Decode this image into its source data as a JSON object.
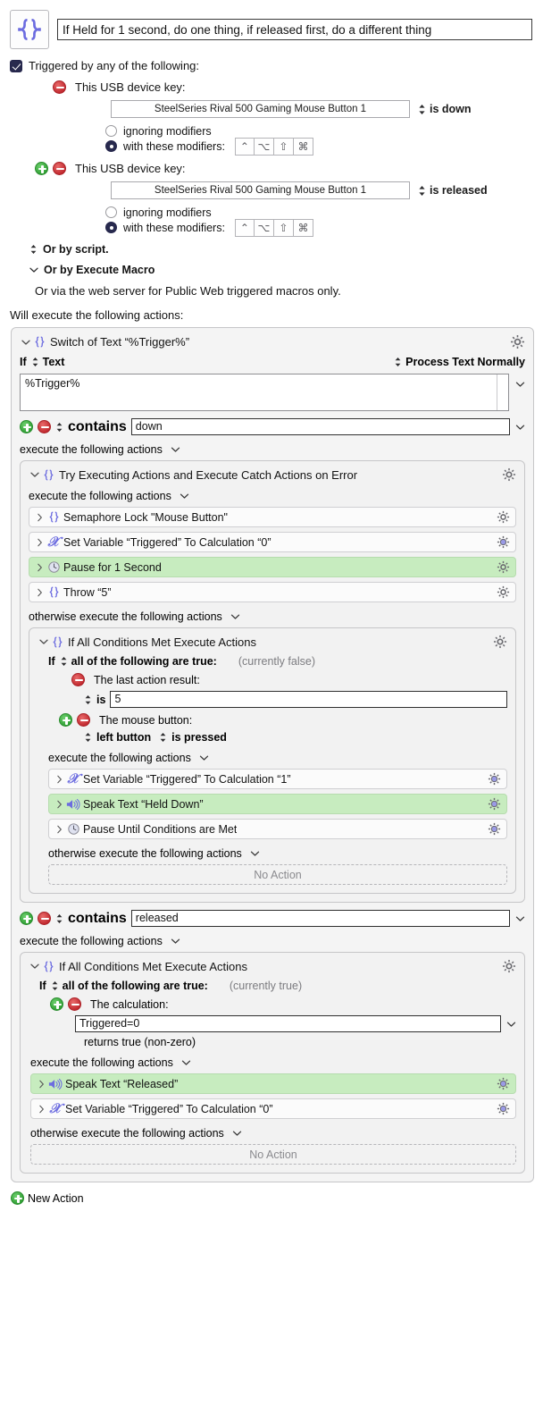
{
  "header": {
    "macro_icon": "braces-icon",
    "title": "If Held for 1 second, do one thing, if released first, do a different thing"
  },
  "triggers": {
    "enabled_label": "Triggered by any of the following:",
    "checkbox_checked": true,
    "items": [
      {
        "kind_label": "This USB device key:",
        "has_add": false,
        "device": "SteelSeries Rival 500 Gaming Mouse Button 1",
        "state": "is down",
        "radio_ignoring": "ignoring modifiers",
        "radio_with": "with these modifiers:",
        "selected": "with",
        "modifiers": [
          "⌃",
          "⌥",
          "⇧",
          "⌘"
        ]
      },
      {
        "kind_label": "This USB device key:",
        "has_add": true,
        "device": "SteelSeries Rival 500 Gaming Mouse Button 1",
        "state": "is released",
        "radio_ignoring": "ignoring modifiers",
        "radio_with": "with these modifiers:",
        "selected": "with",
        "modifiers": [
          "⌃",
          "⌥",
          "⇧",
          "⌘"
        ]
      }
    ],
    "or_by_script": "Or by script.",
    "or_by_execute_macro": "Or by Execute Macro",
    "web_note": "Or via the web server for Public Web triggered macros only."
  },
  "actions_header": "Will execute the following actions:",
  "switch": {
    "title": "Switch of Text “%Trigger%”",
    "if_label": "If",
    "source_label": "Text",
    "process_label": "Process Text Normally",
    "source_value": "%Trigger%",
    "case1": {
      "operator": "contains",
      "value": "down",
      "exec_label": "execute the following actions",
      "try_group": {
        "title": "Try Executing Actions and Execute Catch Actions on Error",
        "exec_label": "execute the following actions",
        "actions": [
          {
            "icon": "braces-icon",
            "text": "Semaphore Lock \"Mouse Button\"",
            "highlight": false,
            "gear": "gear-icon"
          },
          {
            "icon": "script-x-icon",
            "text": "Set Variable “Triggered” To Calculation “0”",
            "highlight": false,
            "gear": "gear-blue-icon"
          },
          {
            "icon": "clock-icon",
            "text": "Pause for 1 Second",
            "highlight": true,
            "gear": "gear-clock-icon"
          },
          {
            "icon": "braces-icon",
            "text": "Throw “5”",
            "highlight": false,
            "gear": "gear-icon"
          }
        ],
        "otherwise_label": "otherwise execute the following actions",
        "if_group": {
          "title": "If All Conditions Met Execute Actions",
          "if_label": "If",
          "all_label": "all of the following are true:",
          "currently": "(currently false)",
          "conditions": [
            {
              "has_add": false,
              "label": "The last action result:",
              "op": "is",
              "value": "5",
              "type": "field"
            },
            {
              "has_add": true,
              "label": "The mouse button:",
              "button": "left button",
              "state": "is pressed",
              "type": "popups"
            }
          ],
          "exec_label": "execute the following actions",
          "actions": [
            {
              "icon": "script-x-icon",
              "text": "Set Variable “Triggered” To Calculation “1”",
              "highlight": false,
              "gear": "gear-blue-icon"
            },
            {
              "icon": "speaker-icon",
              "text": "Speak Text “Held Down”",
              "highlight": true,
              "gear": "gear-clock-icon"
            },
            {
              "icon": "clock-icon",
              "text": "Pause Until Conditions are Met",
              "highlight": false,
              "gear": "gear-blue-icon"
            }
          ],
          "otherwise_label": "otherwise execute the following actions",
          "no_action": "No Action"
        }
      }
    },
    "case2": {
      "operator": "contains",
      "value": "released",
      "exec_label": "execute the following actions",
      "if_group": {
        "title": "If All Conditions Met Execute Actions",
        "if_label": "If",
        "all_label": "all of the following are true:",
        "currently": "(currently true)",
        "condition_label": "The calculation:",
        "calculation": "Triggered=0",
        "returns": "returns true (non-zero)",
        "exec_label": "execute the following actions",
        "actions": [
          {
            "icon": "speaker-icon",
            "text": "Speak Text “Released”",
            "highlight": true,
            "gear": "gear-clock-icon"
          },
          {
            "icon": "script-x-icon",
            "text": "Set Variable “Triggered” To Calculation “0”",
            "highlight": false,
            "gear": "gear-blue-icon"
          }
        ],
        "otherwise_label": "otherwise execute the following actions",
        "no_action": "No Action"
      }
    }
  },
  "footer": {
    "new_action": "New Action"
  },
  "colors": {
    "highlight_green": "#c7ecbf",
    "accent_purple": "#6c6ce0",
    "checkbox_navy": "#282a4e",
    "add_green": "#2e9e32",
    "remove_red": "#c0272d"
  }
}
